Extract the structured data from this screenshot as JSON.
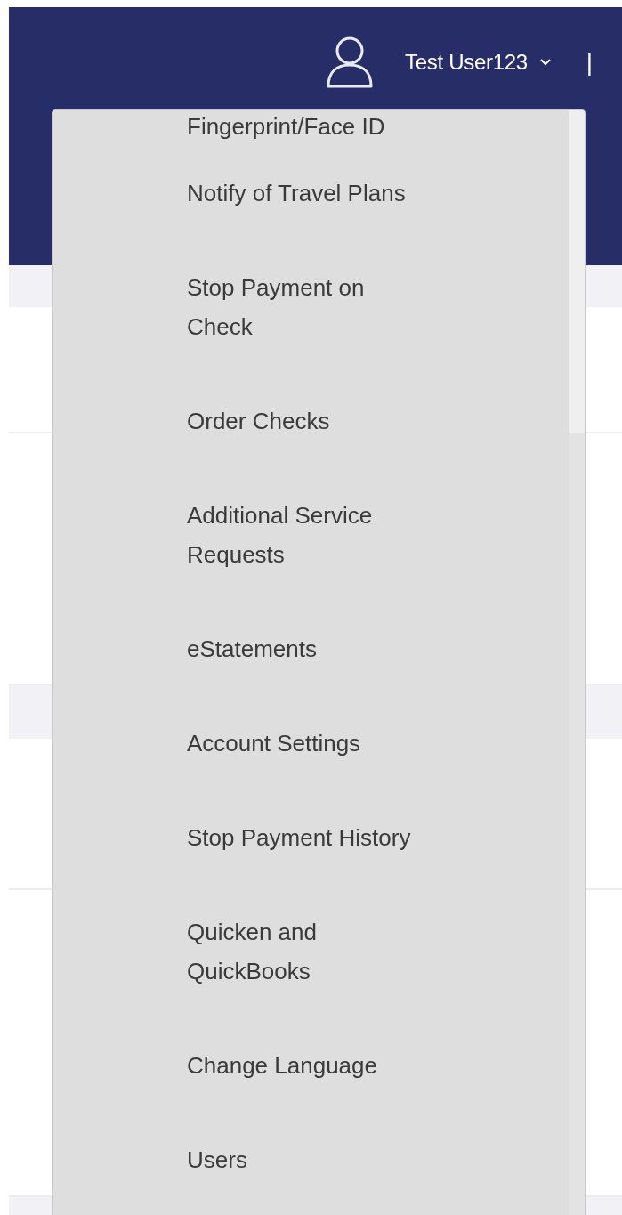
{
  "header": {
    "user_name": "Test User123",
    "separator": "|"
  },
  "user_menu": {
    "items": [
      {
        "label": "Fingerprint/Face ID"
      },
      {
        "label": "Notify of Travel Plans"
      },
      {
        "label": "Stop Payment on Check"
      },
      {
        "label": "Order Checks"
      },
      {
        "label": "Additional Service Requests"
      },
      {
        "label": "eStatements"
      },
      {
        "label": "Account Settings"
      },
      {
        "label": "Stop Payment History"
      },
      {
        "label": "Quicken and QuickBooks"
      },
      {
        "label": "Change Language"
      },
      {
        "label": "Users"
      }
    ]
  }
}
